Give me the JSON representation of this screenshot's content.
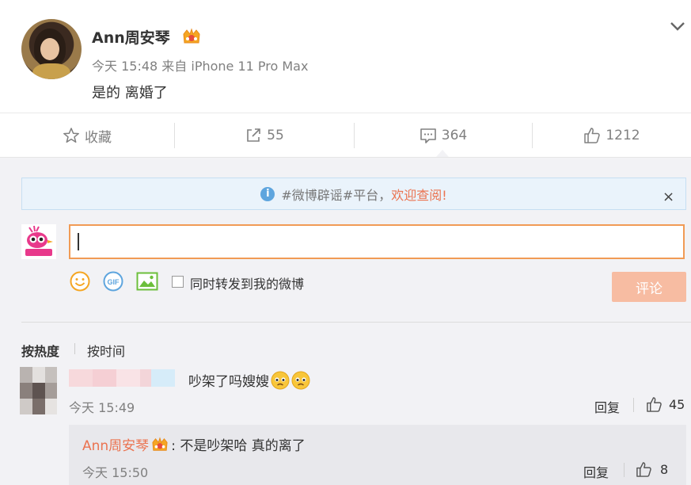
{
  "post": {
    "username": "Ann周安琴",
    "meta": "今天 15:48 来自 iPhone 11 Pro Max",
    "text": "是的 离婚了",
    "verified_icon": "vip-crown-icon"
  },
  "actions": {
    "favorite_label": "收藏",
    "repost_count": "55",
    "comment_count": "364",
    "like_count": "1212"
  },
  "notice": {
    "prefix": "#微博辟谣#平台，",
    "link_text": "欢迎查阅!",
    "close": "×"
  },
  "composer": {
    "repost_label": "同时转发到我的微博",
    "submit_label": "评论",
    "submit_color": "#f7bca2",
    "input_border_color": "#f19b55"
  },
  "sort": {
    "hot_label": "按热度",
    "time_label": "按时间"
  },
  "comments": [
    {
      "text": "吵架了吗嫂嫂",
      "time": "今天 15:49",
      "reply_label": "回复",
      "likes": "45",
      "replies": [
        {
          "username": "Ann周安琴",
          "text": ": 不是吵架哈 真的离了",
          "time": "今天 15:50",
          "reply_label": "回复",
          "likes": "8"
        }
      ]
    }
  ],
  "colors": {
    "accent_orange": "#eb7350",
    "notice_bg": "#eaf3fb",
    "panel_bg": "#f2f2f5"
  }
}
